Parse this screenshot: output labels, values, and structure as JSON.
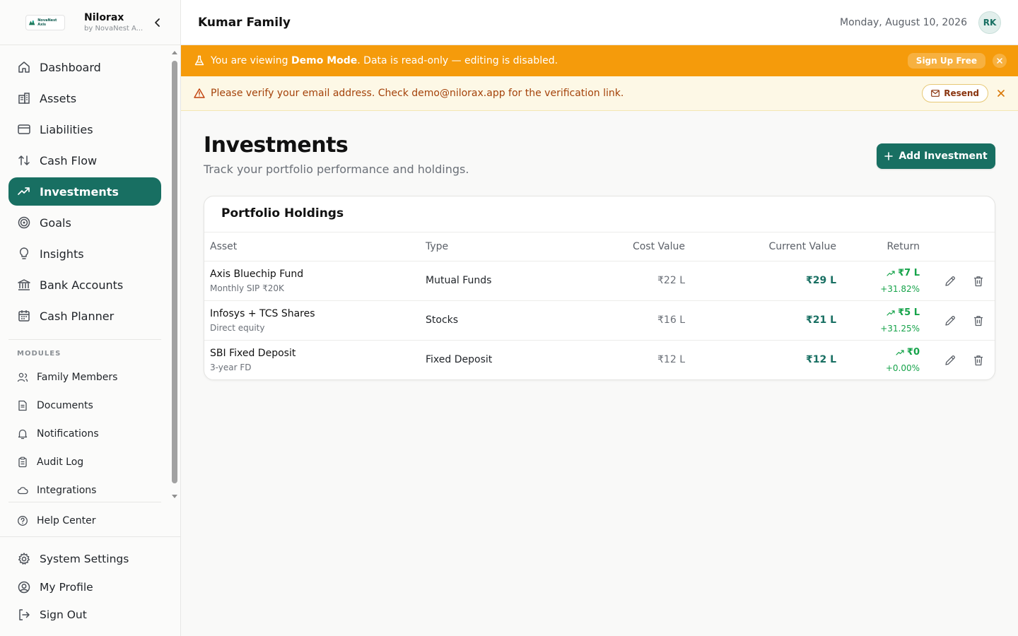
{
  "brand": {
    "name": "Nilorax",
    "subtitle": "by NovaNest A...",
    "logo_text": "NovaNest Axis"
  },
  "nav": [
    {
      "label": "Dashboard",
      "icon": "home-icon"
    },
    {
      "label": "Assets",
      "icon": "building-icon"
    },
    {
      "label": "Liabilities",
      "icon": "credit-card-icon"
    },
    {
      "label": "Cash Flow",
      "icon": "arrows-up-down-icon"
    },
    {
      "label": "Investments",
      "icon": "trending-up-icon",
      "active": true
    },
    {
      "label": "Goals",
      "icon": "target-icon"
    },
    {
      "label": "Insights",
      "icon": "lightbulb-icon"
    },
    {
      "label": "Bank Accounts",
      "icon": "bank-icon"
    },
    {
      "label": "Cash Planner",
      "icon": "calendar-icon"
    }
  ],
  "modules": {
    "label": "MODULES",
    "items": [
      {
        "label": "Family Members",
        "icon": "users-icon"
      },
      {
        "label": "Documents",
        "icon": "document-icon"
      },
      {
        "label": "Notifications",
        "icon": "bell-icon"
      },
      {
        "label": "Audit Log",
        "icon": "clipboard-icon"
      },
      {
        "label": "Integrations",
        "icon": "cloud-icon"
      }
    ]
  },
  "help": {
    "label": "Help Center"
  },
  "bottom_nav": [
    {
      "label": "System Settings",
      "icon": "gear-icon"
    },
    {
      "label": "My Profile",
      "icon": "user-circle-icon"
    },
    {
      "label": "Sign Out",
      "icon": "sign-out-icon"
    }
  ],
  "header": {
    "family": "Kumar Family",
    "date": "Monday, August 10, 2026",
    "avatar": "RK"
  },
  "demo_banner": {
    "prefix": "You are viewing ",
    "mode": "Demo Mode",
    "suffix": ". Data is read-only — editing is disabled.",
    "cta": "Sign Up Free",
    "color": "#f59b0b"
  },
  "verify_banner": {
    "text": "Please verify your email address. Check demo@nilorax.app for the verification link.",
    "button": "Resend"
  },
  "page": {
    "title": "Investments",
    "subtitle": "Track your portfolio performance and holdings.",
    "add_button": "Add Investment"
  },
  "holdings": {
    "title": "Portfolio Holdings",
    "columns": [
      "Asset",
      "Type",
      "Cost Value",
      "Current Value",
      "Return"
    ],
    "rows": [
      {
        "name": "Axis Bluechip Fund",
        "note": "Monthly SIP ₹20K",
        "type": "Mutual Funds",
        "cost": "₹22 L",
        "current": "₹29 L",
        "return": "₹7 L",
        "return_pct": "+31.82%"
      },
      {
        "name": "Infosys + TCS Shares",
        "note": "Direct equity",
        "type": "Stocks",
        "cost": "₹16 L",
        "current": "₹21 L",
        "return": "₹5 L",
        "return_pct": "+31.25%"
      },
      {
        "name": "SBI Fixed Deposit",
        "note": "3-year FD",
        "type": "Fixed Deposit",
        "cost": "₹12 L",
        "current": "₹12 L",
        "return": "₹0",
        "return_pct": "+0.00%"
      }
    ]
  },
  "colors": {
    "accent": "#186f62",
    "positive": "#16a34a",
    "warning_bg": "#fdf8e6",
    "warning_text": "#a4420a"
  }
}
